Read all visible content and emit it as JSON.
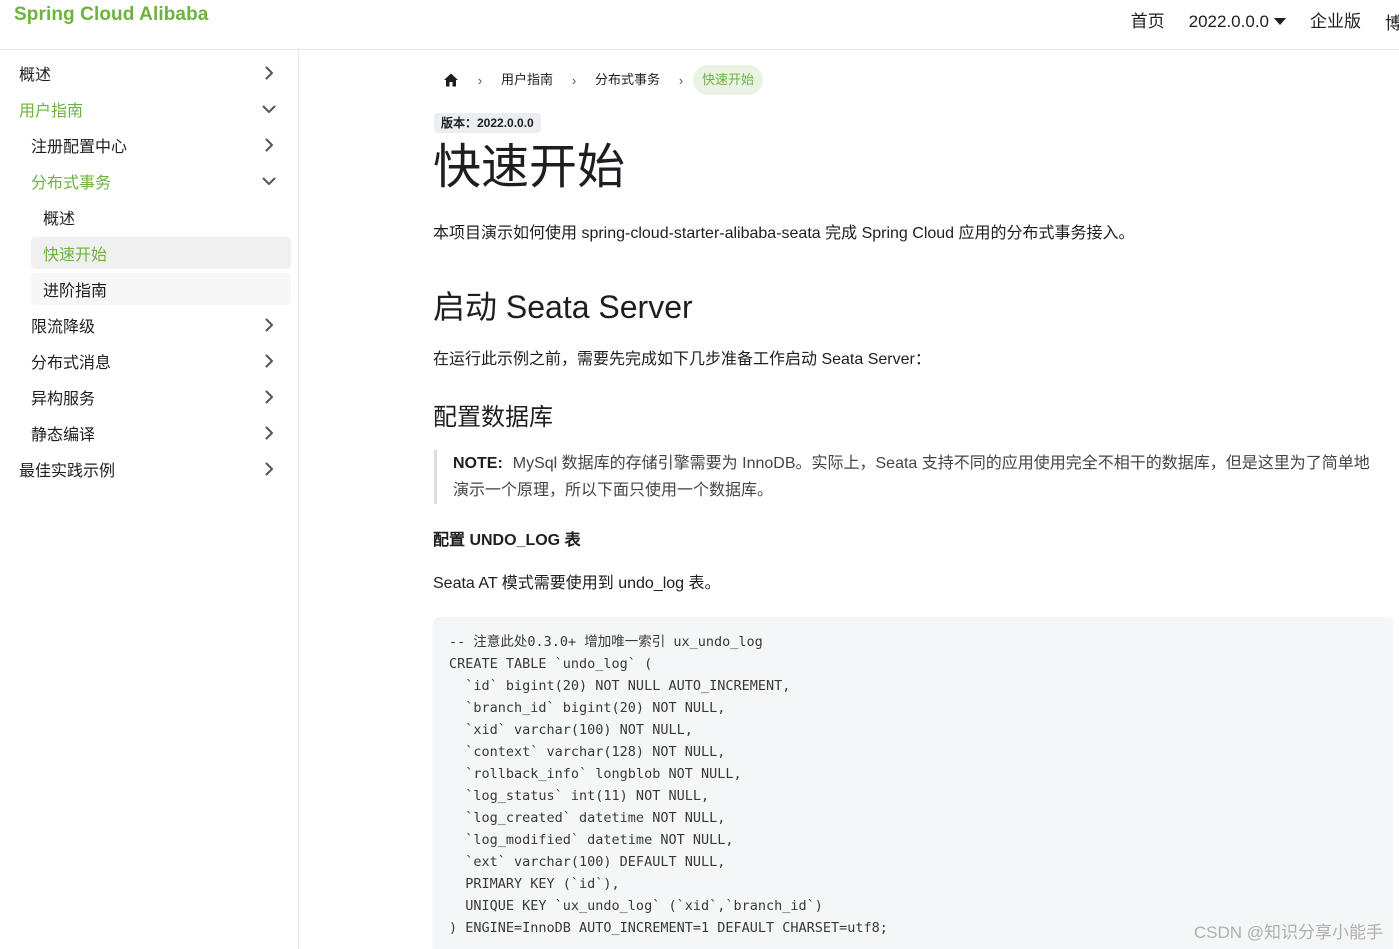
{
  "header": {
    "brand": "Spring Cloud Alibaba",
    "nav": [
      {
        "label": "首页"
      },
      {
        "label": "2022.0.0.0"
      },
      {
        "label": "企业版"
      },
      {
        "label": "博"
      }
    ]
  },
  "sidebar": {
    "items": [
      {
        "label": "概述"
      },
      {
        "label": "用户指南"
      },
      {
        "label": "注册配置中心"
      },
      {
        "label": "分布式事务"
      },
      {
        "label": "概述"
      },
      {
        "label": "快速开始"
      },
      {
        "label": "进阶指南"
      },
      {
        "label": "限流降级"
      },
      {
        "label": "分布式消息"
      },
      {
        "label": "异构服务"
      },
      {
        "label": "静态编译"
      },
      {
        "label": "最佳实践示例"
      }
    ]
  },
  "breadcrumb": [
    "用户指南",
    "分布式事务",
    "快速开始"
  ],
  "content": {
    "version_badge": "版本：2022.0.0.0",
    "title": "快速开始",
    "intro": "本项目演示如何使用 spring-cloud-starter-alibaba-seata 完成 Spring Cloud 应用的分布式事务接入。",
    "h2": "启动 Seata Server",
    "h2_text": "在运行此示例之前，需要先完成如下几步准备工作启动 Seata Server：",
    "h3": "配置数据库",
    "note_label": "NOTE:",
    "note_text": "MySql 数据库的存储引擎需要为 InnoDB。实际上，Seata 支持不同的应用使用完全不相干的数据库，但是这里为了简单地演示一个原理，所以下面只使用一个数据库。",
    "h5": "配置 UNDO_LOG 表",
    "h5_text": "Seata AT 模式需要使用到 undo_log 表。",
    "code": "-- 注意此处0.3.0+ 增加唯一索引 ux_undo_log\nCREATE TABLE `undo_log` (\n  `id` bigint(20) NOT NULL AUTO_INCREMENT,\n  `branch_id` bigint(20) NOT NULL,\n  `xid` varchar(100) NOT NULL,\n  `context` varchar(128) NOT NULL,\n  `rollback_info` longblob NOT NULL,\n  `log_status` int(11) NOT NULL,\n  `log_created` datetime NOT NULL,\n  `log_modified` datetime NOT NULL,\n  `ext` varchar(100) DEFAULT NULL,\n  PRIMARY KEY (`id`),\n  UNIQUE KEY `ux_undo_log` (`xid`,`branch_id`)\n) ENGINE=InnoDB AUTO_INCREMENT=1 DEFAULT CHARSET=utf8;"
  },
  "watermark": "CSDN @知识分享小能手",
  "colors": {
    "accent": "#6cb33e",
    "active_bg": "#f0f0f0",
    "code_bg": "#f5f6f7"
  }
}
